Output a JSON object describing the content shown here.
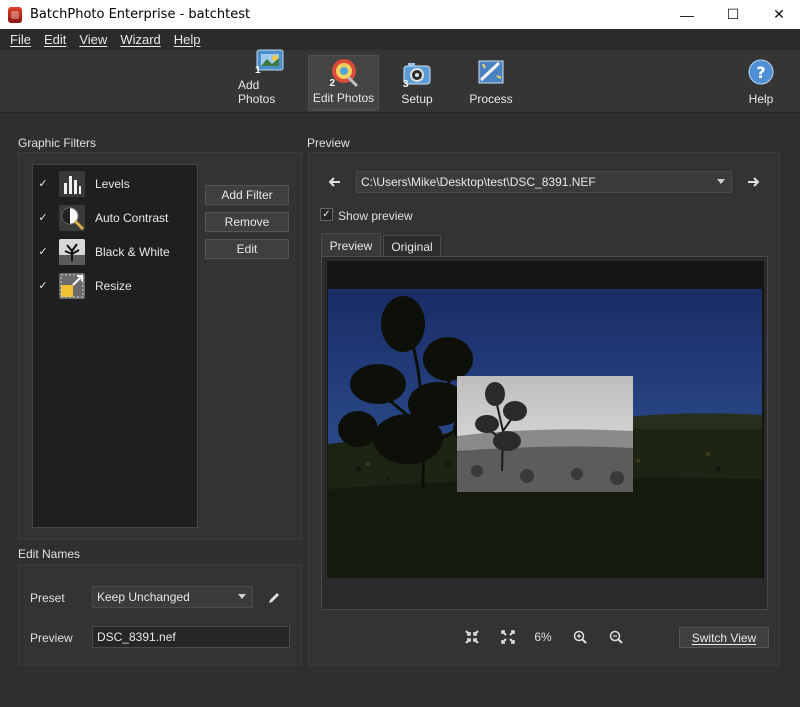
{
  "window": {
    "title": "BatchPhoto Enterprise - batchtest"
  },
  "menu": [
    "File",
    "Edit",
    "View",
    "Wizard",
    "Help"
  ],
  "toolbar": {
    "add_photos": "Add Photos",
    "edit_photos": "Edit Photos",
    "setup": "Setup",
    "process": "Process",
    "help": "Help",
    "steps": [
      "1",
      "2",
      "3"
    ]
  },
  "filters": {
    "label": "Graphic Filters",
    "items": [
      {
        "name": "Levels",
        "checked": "✓"
      },
      {
        "name": "Auto Contrast",
        "checked": "✓"
      },
      {
        "name": "Black & White",
        "checked": "✓"
      },
      {
        "name": "Resize",
        "checked": "✓"
      }
    ],
    "add_filter": "Add Filter",
    "remove": "Remove",
    "edit": "Edit"
  },
  "edit_names": {
    "label": "Edit Names",
    "preset_label": "Preset",
    "preset_value": "Keep Unchanged",
    "preview_label": "Preview",
    "preview_value": "DSC_8391.nef"
  },
  "preview": {
    "label": "Preview",
    "path": "C:\\Users\\Mike\\Desktop\\test\\DSC_8391.NEF",
    "show_preview_check": "✓",
    "show_preview": "Show preview",
    "tab_preview": "Preview",
    "tab_original": "Original",
    "zoom": "6%",
    "switch_view": "Switch View"
  },
  "colors": {
    "accent": "#3b8fd9",
    "bg": "#2f2f2f"
  }
}
